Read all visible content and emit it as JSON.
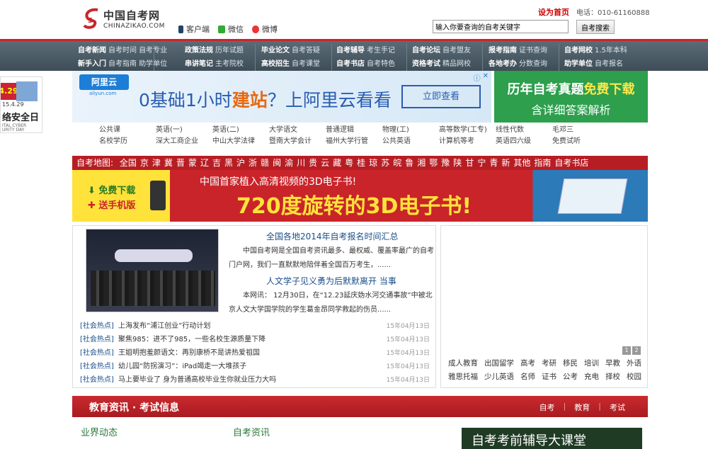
{
  "header": {
    "site_name_cn": "中国自考网",
    "site_name_en": "CHINAZIKAO.COM",
    "links": [
      "客户端",
      "微信",
      "微博"
    ],
    "set_home": "设为首页",
    "phone": "电话：010-61160888",
    "search_placeholder": "输入你要查询的自考关键字",
    "search_button": "自考搜索"
  },
  "nav": [
    {
      "rows": [
        [
          "自考新闻",
          "自考时间 自考专业"
        ],
        [
          "新手入门",
          "自考指南 助学单位"
        ]
      ]
    },
    {
      "rows": [
        [
          "政策法规",
          "历年试题"
        ],
        [
          "串讲笔记",
          "主考院校"
        ]
      ]
    },
    {
      "rows": [
        [
          "毕业论文",
          "自考答疑"
        ],
        [
          "高校招生",
          "自考课堂"
        ]
      ]
    },
    {
      "rows": [
        [
          "自考辅导",
          "考生手记"
        ],
        [
          "自考书店",
          "自考特色"
        ]
      ]
    },
    {
      "rows": [
        [
          "自考论坛",
          "自考盟友"
        ],
        [
          "资格考试",
          "精品网校"
        ]
      ]
    },
    {
      "rows": [
        [
          "报考指南",
          "证书查询"
        ],
        [
          "各地考办",
          "分数查询"
        ]
      ]
    },
    {
      "rows": [
        [
          "自考网校",
          "1.5年本科"
        ],
        [
          "助学单位",
          "自考报名"
        ]
      ]
    }
  ],
  "ad_left": {
    "badge": "4.29",
    "date": "15.4.29",
    "title": "络安全日",
    "small": [
      "ITAL CYBER",
      "URITY DAY"
    ]
  },
  "ad_aliyun": {
    "logo": "阿里云",
    "logo_sub": "aliyun.com",
    "text_pre": "0基础1小时",
    "text_em": "建站",
    "text_post": "？上阿里云看看",
    "button": "立即查看"
  },
  "ad_zhenti": {
    "line1_pre": "历年自考真题",
    "line1_em": "免费下载",
    "line2": "含详细答案解析"
  },
  "subjects": [
    [
      "公共课",
      "英语(一)",
      "英语(二)",
      "大学语文",
      "普通逻辑",
      "物理(工)",
      "高等数学(工专)",
      "线性代数",
      "毛邓三"
    ],
    [
      "名校学历",
      "深大工商企业",
      "中山大学法律",
      "暨南大学会计",
      "福州大学行管",
      "公共英语",
      "计算机等考",
      "英语四六级",
      "免费试听"
    ]
  ],
  "map_bar": {
    "label": "自考地图:",
    "items": [
      "全国",
      "京",
      "津",
      "冀",
      "晋",
      "蒙",
      "辽",
      "吉",
      "黑",
      "沪",
      "浙",
      "赣",
      "闽",
      "渝",
      "川",
      "贵",
      "云",
      "藏",
      "粤",
      "桂",
      "琼",
      "苏",
      "皖",
      "鲁",
      "湘",
      "鄂",
      "豫",
      "陕",
      "甘",
      "宁",
      "青",
      "新",
      "其他",
      "指南",
      "自考书店"
    ]
  },
  "ad_3d": {
    "free_download": "免费下载",
    "send_mobile": "送手机版",
    "headline1": "中国首家植入高清视频的3D电子书!",
    "headline2": "720度旋转的3D电子书!"
  },
  "news": {
    "top1_title": "全国各地2014年自考报名时间汇总",
    "top1_summary": "中国自考网是全国自考资讯最多、最权威、覆盖率最广的自考门户网，我们一直默默地陪伴着全国百万考生，......",
    "top2_title": "人文学子见义勇为后默默离开 当事",
    "top2_summary": "本网讯： 12月30日，在“12.23延庆妫水河交通事故”中被北京人文大学国学院的学生葛金昂同学救起的伤员......",
    "headlines": [
      {
        "tag": "[社会热点]",
        "title": "上海发布“浦江创业”行动计划",
        "date": "15年04月13日"
      },
      {
        "tag": "[社会热点]",
        "title": "聚焦985：进不了985，一些名校生源质量下降",
        "date": "15年04月13日"
      },
      {
        "tag": "[社会热点]",
        "title": "王姐明抱羞颜语文：再别康桥不是讲热爱祖国",
        "date": "15年04月13日"
      },
      {
        "tag": "[社会热点]",
        "title": "幼儿园“防拐演习”：iPad竭走一大堆孩子",
        "date": "15年04月13日"
      },
      {
        "tag": "[社会热点]",
        "title": "马上要毕业了 身为普通高校毕业生你就业压力大吗",
        "date": "15年04月13日"
      }
    ]
  },
  "right_links": {
    "pages": [
      "1",
      "2"
    ],
    "rows": [
      [
        "成人教育",
        "出国留学",
        "高考",
        "考研",
        "移民",
        "培训",
        "早教",
        "外语"
      ],
      [
        "雅思托福",
        "少儿英语",
        "名师",
        "证书",
        "公考",
        "充电",
        "择校",
        "校园"
      ]
    ]
  },
  "edu_bar": {
    "title": "教育资讯 · 考试信息",
    "tabs": [
      "自考",
      "教育",
      "考试"
    ]
  },
  "section_heads": [
    "业界动态",
    "自考资讯"
  ],
  "dark_banner": "自考考前辅导大课堂",
  "colors": {
    "brand_red": "#b71e24",
    "nav_bg": "#4a5a65",
    "link_blue": "#1a4f8a",
    "green": "#2a7a3a"
  }
}
